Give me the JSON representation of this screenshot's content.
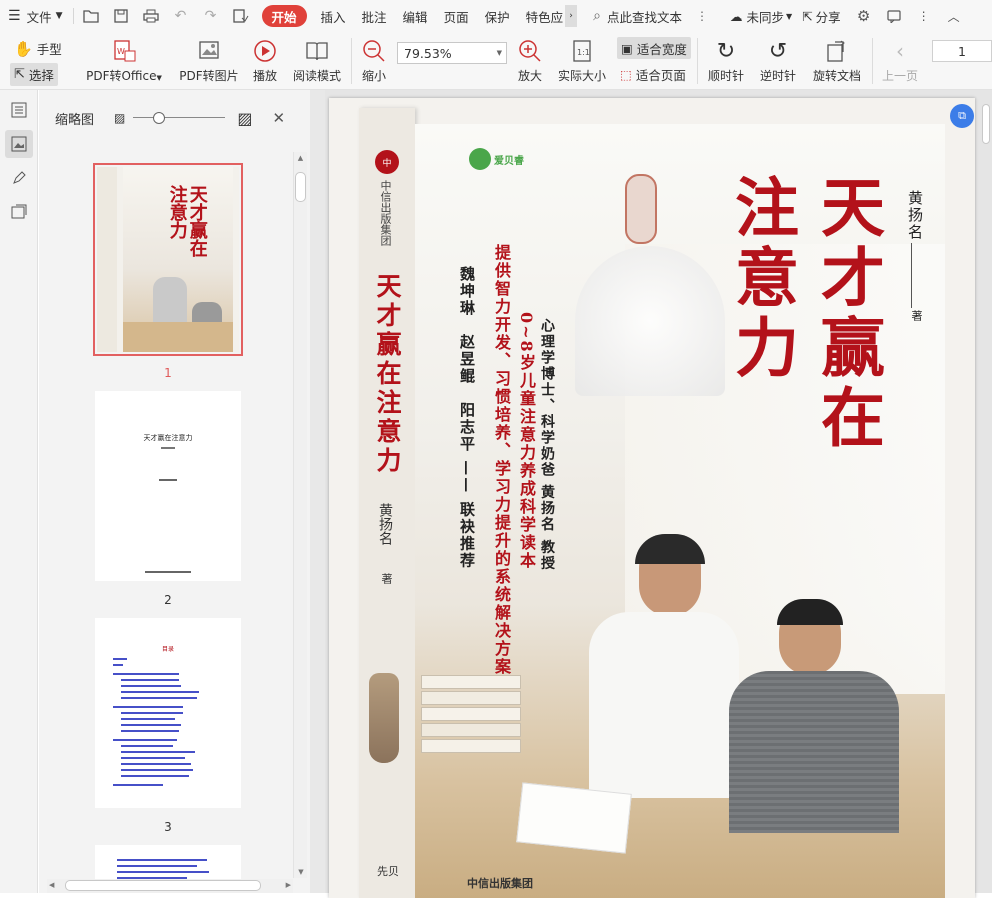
{
  "menubar": {
    "file": "文件",
    "tabs": [
      "开始",
      "插入",
      "批注",
      "编辑",
      "页面",
      "保护",
      "特色应"
    ],
    "search": "点此查找文本",
    "sync": "未同步",
    "share": "分享"
  },
  "toolbar": {
    "hand": "手型",
    "select": "选择",
    "pdf_office": "PDF转Office",
    "pdf_image": "PDF转图片",
    "play": "播放",
    "read_mode": "阅读模式",
    "zoom_value": "79.53%",
    "zoom_out": "缩小",
    "zoom_in": "放大",
    "actual_size": "实际大小",
    "fit_width": "适合宽度",
    "fit_page": "适合页面",
    "rotate_cw": "顺时针",
    "rotate_ccw": "逆时针",
    "rotate_doc": "旋转文档",
    "prev_page": "上一页",
    "page_number": "1"
  },
  "thumbnails": {
    "title": "缩略图",
    "pages": [
      {
        "label": "1"
      },
      {
        "label": "2",
        "title": "天才赢在注意力"
      },
      {
        "label": "3",
        "title": "目录"
      }
    ]
  },
  "cover": {
    "publisher_vertical": "中信出版集团",
    "spine_title": "天才赢在注意力",
    "spine_author": "黄扬名",
    "spine_author_suffix": "著",
    "logo_text": "爱贝睿",
    "title_col1": "天才赢在",
    "title_col2": "注意力",
    "author_line": "黄扬名",
    "author_suffix": "著",
    "subtitle1": "心理学博士、科学奶爸 黄扬名 教授",
    "subtitle2": "0~8岁儿童注意力养成科学读本",
    "subtitle3": "提供智力开发、习惯培养、学习力提升的系统解决方案",
    "recommend": "魏坤琳　赵昱鲲　阳志平 —— 联袂推荐",
    "footer_left": "先贝",
    "footer_right": "中信出版集团"
  },
  "colors": {
    "accent": "#e0413a",
    "title_red": "#b3121a",
    "toolbar_bg": "#f7f7f7"
  }
}
